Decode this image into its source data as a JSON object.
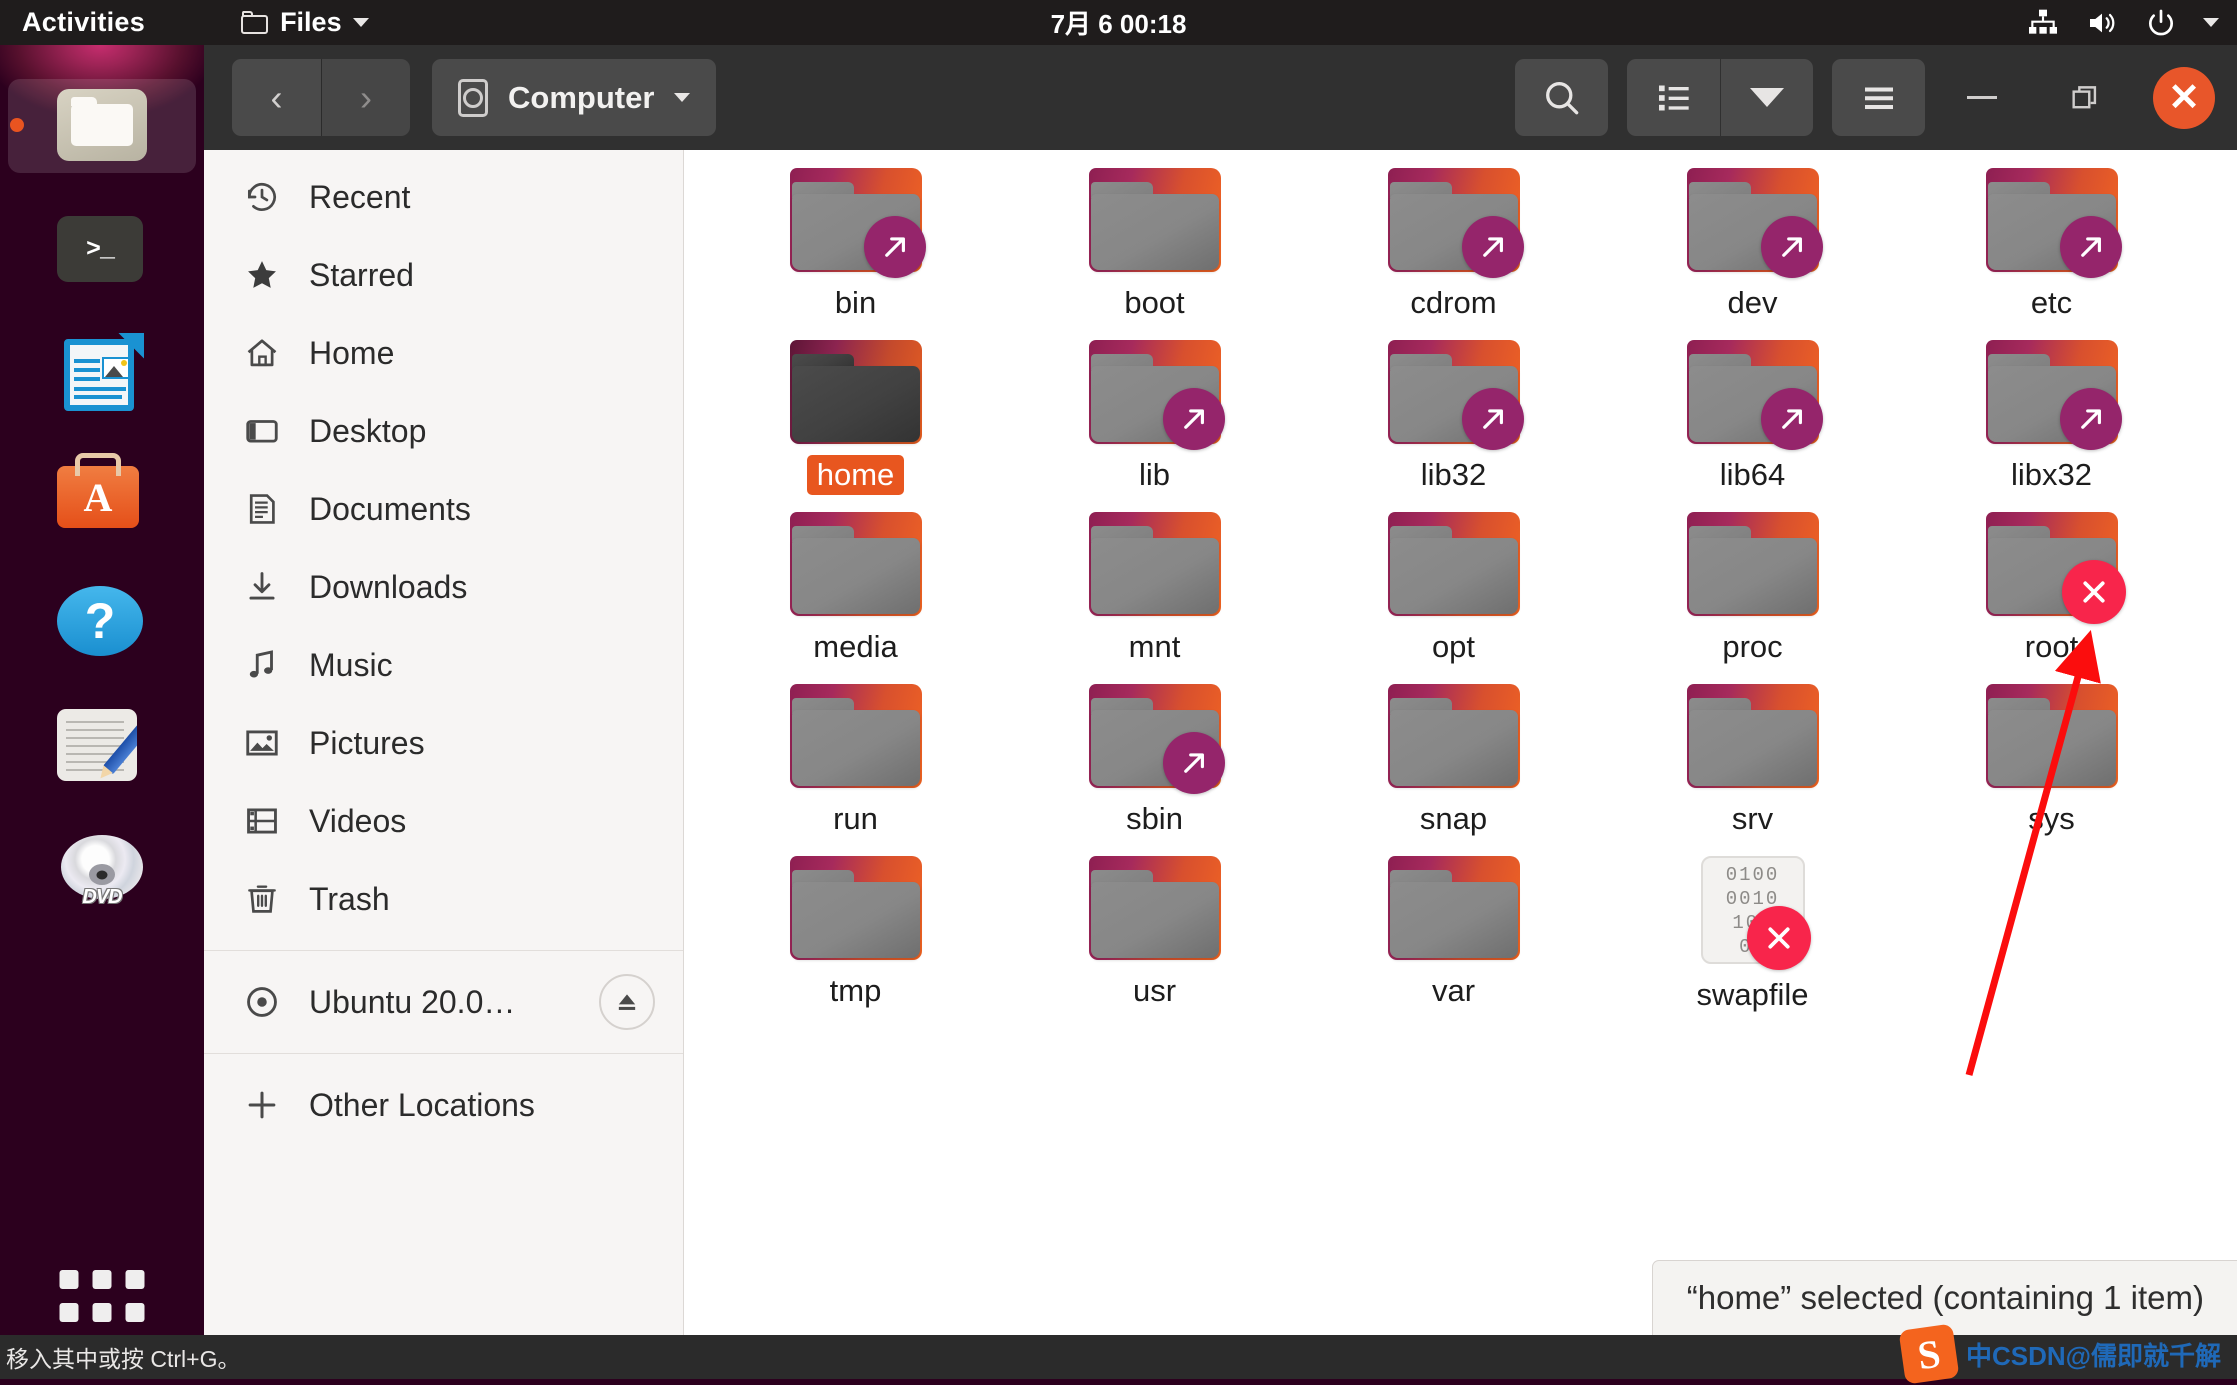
{
  "topbar": {
    "activities": "Activities",
    "app_name": "Files",
    "clock": "7月 6  00:18",
    "icons": [
      "folder-icon",
      "chevron-down-icon",
      "network-icon",
      "volume-icon",
      "power-icon",
      "chevron-down-icon"
    ]
  },
  "dock": {
    "items": [
      {
        "name": "files",
        "label": "Files",
        "active": true
      },
      {
        "name": "terminal",
        "label": "Terminal",
        "glyph": ">_"
      },
      {
        "name": "libreoffice-writer",
        "label": "LibreOffice Writer"
      },
      {
        "name": "ubuntu-software",
        "label": "Ubuntu Software",
        "glyph": "A"
      },
      {
        "name": "help",
        "label": "Help",
        "glyph": "?"
      },
      {
        "name": "text-editor",
        "label": "Text Editor"
      },
      {
        "name": "dvd-drive",
        "label": "Ubuntu 20.0",
        "glyph": "DVD"
      }
    ],
    "show_applications": "Show Applications"
  },
  "window": {
    "headerbar": {
      "back_label": "‹",
      "forward_label": "›",
      "path_label": "Computer",
      "buttons": [
        "search-icon",
        "list-view-icon",
        "view-options-chevron-icon",
        "hamburger-menu-icon"
      ],
      "minimize_label": "–",
      "maximize_label": "❐",
      "close_label": "✕"
    },
    "sidebar": {
      "items": [
        {
          "label": "Recent",
          "icon": "history-clock-icon"
        },
        {
          "label": "Starred",
          "icon": "star-icon"
        },
        {
          "label": "Home",
          "icon": "home-icon"
        },
        {
          "label": "Desktop",
          "icon": "desktop-icon"
        },
        {
          "label": "Documents",
          "icon": "document-icon"
        },
        {
          "label": "Downloads",
          "icon": "download-arrow-icon"
        },
        {
          "label": "Music",
          "icon": "music-note-icon"
        },
        {
          "label": "Pictures",
          "icon": "picture-icon"
        },
        {
          "label": "Videos",
          "icon": "film-icon"
        },
        {
          "label": "Trash",
          "icon": "trash-icon"
        }
      ],
      "devices": [
        {
          "label": "Ubuntu 20.0…",
          "icon": "disc-icon",
          "action": "eject-icon"
        }
      ],
      "other_locations": {
        "label": "Other Locations",
        "icon": "plus-icon"
      }
    },
    "files": [
      {
        "name": "bin",
        "type": "folder",
        "badge": "symlink"
      },
      {
        "name": "boot",
        "type": "folder",
        "badge": "none"
      },
      {
        "name": "cdrom",
        "type": "folder",
        "badge": "symlink"
      },
      {
        "name": "dev",
        "type": "folder",
        "badge": "symlink"
      },
      {
        "name": "etc",
        "type": "folder",
        "badge": "symlink"
      },
      {
        "name": "home",
        "type": "folder",
        "badge": "none",
        "selected": true
      },
      {
        "name": "lib",
        "type": "folder",
        "badge": "symlink"
      },
      {
        "name": "lib32",
        "type": "folder",
        "badge": "symlink"
      },
      {
        "name": "lib64",
        "type": "folder",
        "badge": "symlink"
      },
      {
        "name": "libx32",
        "type": "folder",
        "badge": "symlink"
      },
      {
        "name": "media",
        "type": "folder",
        "badge": "none"
      },
      {
        "name": "mnt",
        "type": "folder",
        "badge": "none"
      },
      {
        "name": "opt",
        "type": "folder",
        "badge": "none"
      },
      {
        "name": "proc",
        "type": "folder",
        "badge": "none"
      },
      {
        "name": "root",
        "type": "folder",
        "badge": "denied"
      },
      {
        "name": "run",
        "type": "folder",
        "badge": "none"
      },
      {
        "name": "sbin",
        "type": "folder",
        "badge": "symlink"
      },
      {
        "name": "snap",
        "type": "folder",
        "badge": "none"
      },
      {
        "name": "srv",
        "type": "folder",
        "badge": "none"
      },
      {
        "name": "sys",
        "type": "folder",
        "badge": "none"
      },
      {
        "name": "tmp",
        "type": "folder",
        "badge": "none"
      },
      {
        "name": "usr",
        "type": "folder",
        "badge": "none"
      },
      {
        "name": "var",
        "type": "folder",
        "badge": "none"
      },
      {
        "name": "swapfile",
        "type": "binary",
        "badge": "denied",
        "binary_rows": [
          "0100",
          "0010",
          "100",
          "01"
        ]
      }
    ],
    "status": "“home” selected  (containing 1 item)"
  },
  "ime": {
    "hint": "移入其中或按 Ctrl+G。",
    "watermark": "中CSDN@儒即就千解",
    "watermark_logo": "S"
  },
  "annotation": {
    "arrow_color": "#fb0d0d",
    "points_to": "root"
  },
  "colors": {
    "accent": "#e95420",
    "panel_dark": "#1f1c1c",
    "header_dark": "#303030",
    "sidebar_bg": "#f7f5f4",
    "deny_badge": "#f8254b",
    "link_badge": "#95256b"
  }
}
